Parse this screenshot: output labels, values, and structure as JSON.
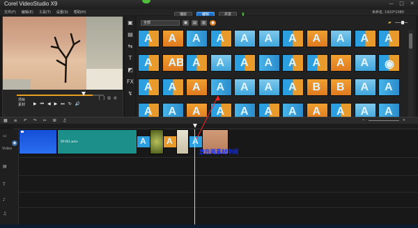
{
  "window": {
    "title": "Corel VideoStudio X9",
    "title_brand": "Corel",
    "title_product": "VideoStudio X9",
    "controls": [
      "—",
      "□",
      "✕"
    ]
  },
  "menu": {
    "items": [
      "文件(F)",
      "编辑(E)",
      "工具(T)",
      "设置(S)",
      "帮助(H)"
    ],
    "workspace_tabs": [
      "捕获",
      "编辑",
      "共享"
    ],
    "active_tab": 1,
    "info_text": "未命名, 1920*1080"
  },
  "preview": {
    "mode_labels": [
      "项目",
      "素材"
    ],
    "transport": [
      "▶",
      "⏮",
      "◀",
      "▶",
      "⏭",
      "↻",
      "🔊"
    ],
    "progress": 0.87,
    "right_icons": [
      "[",
      "]",
      "⧉",
      "⚙"
    ]
  },
  "library": {
    "category": "全部",
    "tool_icons": [
      "media-icon",
      "instant-project-icon",
      "transition-icon",
      "title-icon",
      "graphics-icon",
      "filter-icon",
      "path-icon"
    ],
    "toolbar_icons": [
      "▣",
      "▤",
      "▥",
      "●"
    ],
    "thumbnails": [
      {
        "label": "",
        "glyph": "A",
        "style": "v1"
      },
      {
        "label": "",
        "glyph": "A",
        "style": "v2"
      },
      {
        "label": "",
        "glyph": "A",
        "style": "v3"
      },
      {
        "label": "",
        "glyph": "A",
        "style": "v1"
      },
      {
        "label": "",
        "glyph": "A",
        "style": "v4"
      },
      {
        "label": "",
        "glyph": "A",
        "style": "v4"
      },
      {
        "label": "",
        "glyph": "A",
        "style": "v1"
      },
      {
        "label": "",
        "glyph": "A",
        "style": "v2"
      },
      {
        "label": "",
        "glyph": "A",
        "style": "v4"
      },
      {
        "label": "",
        "glyph": "A",
        "style": "v1"
      },
      {
        "label": "",
        "glyph": "A",
        "style": "v1"
      },
      {
        "label": "",
        "glyph": "A",
        "style": "v1"
      },
      {
        "label": "",
        "glyph": "AB",
        "style": "v2"
      },
      {
        "label": "",
        "glyph": "A",
        "style": "v1"
      },
      {
        "label": "",
        "glyph": "A",
        "style": "v4"
      },
      {
        "label": "",
        "glyph": "A",
        "style": "v1"
      },
      {
        "label": "",
        "glyph": "A",
        "style": "v3"
      },
      {
        "label": "",
        "glyph": "A",
        "style": "v1"
      },
      {
        "label": "",
        "glyph": "A",
        "style": "v1"
      },
      {
        "label": "",
        "glyph": "A",
        "style": "v2"
      },
      {
        "label": "",
        "glyph": "A",
        "style": "v4"
      },
      {
        "label": "",
        "glyph": "◉",
        "style": "v1"
      },
      {
        "label": "",
        "glyph": "A",
        "style": "v1"
      },
      {
        "label": "",
        "glyph": "A",
        "style": "v1"
      },
      {
        "label": "",
        "glyph": "A",
        "style": "v2"
      },
      {
        "label": "",
        "glyph": "A",
        "style": "v3"
      },
      {
        "label": "",
        "glyph": "A",
        "style": "v4"
      },
      {
        "label": "",
        "glyph": "A",
        "style": "v4"
      },
      {
        "label": "",
        "glyph": "A",
        "style": "v1"
      },
      {
        "label": "",
        "glyph": "B",
        "style": "v2"
      },
      {
        "label": "",
        "glyph": "B",
        "style": "v2"
      },
      {
        "label": "",
        "glyph": "A",
        "style": "v4"
      },
      {
        "label": "",
        "glyph": "A",
        "style": "v3"
      },
      {
        "label": "",
        "glyph": "A",
        "style": "v1"
      },
      {
        "label": "",
        "glyph": "A",
        "style": "v3"
      },
      {
        "label": "",
        "glyph": "A",
        "style": "v2"
      },
      {
        "label": "",
        "glyph": "A",
        "style": "v1"
      },
      {
        "label": "",
        "glyph": "A",
        "style": "v3"
      },
      {
        "label": "",
        "glyph": "A",
        "style": "v1"
      },
      {
        "label": "",
        "glyph": "A",
        "style": "v3"
      },
      {
        "label": "",
        "glyph": "A",
        "style": "v2"
      },
      {
        "label": "",
        "glyph": "A",
        "style": "v1"
      },
      {
        "label": "",
        "glyph": "A",
        "style": "v4"
      },
      {
        "label": "",
        "glyph": "A",
        "style": "v3"
      }
    ]
  },
  "timeline": {
    "toolbar_icons": [
      "▦",
      "≡",
      "↶",
      "↷",
      "✂",
      "⊞",
      "♫"
    ],
    "zoom_controls": [
      "−",
      "+"
    ],
    "tracks": [
      "视频",
      "叠加",
      "标题",
      "声音",
      "音乐"
    ],
    "video_track_name": "Video",
    "clips": [
      {
        "name": "SP-V01.wmv",
        "color": "#1d8f8a"
      }
    ],
    "transitions": [
      "A",
      "A",
      "A"
    ],
    "annotation": "放在两素材中间"
  },
  "colors": {
    "accent": "#2b7fd4",
    "orange": "#e89a2a",
    "annotation": "#1030ff",
    "arrow": "#ff2020"
  }
}
